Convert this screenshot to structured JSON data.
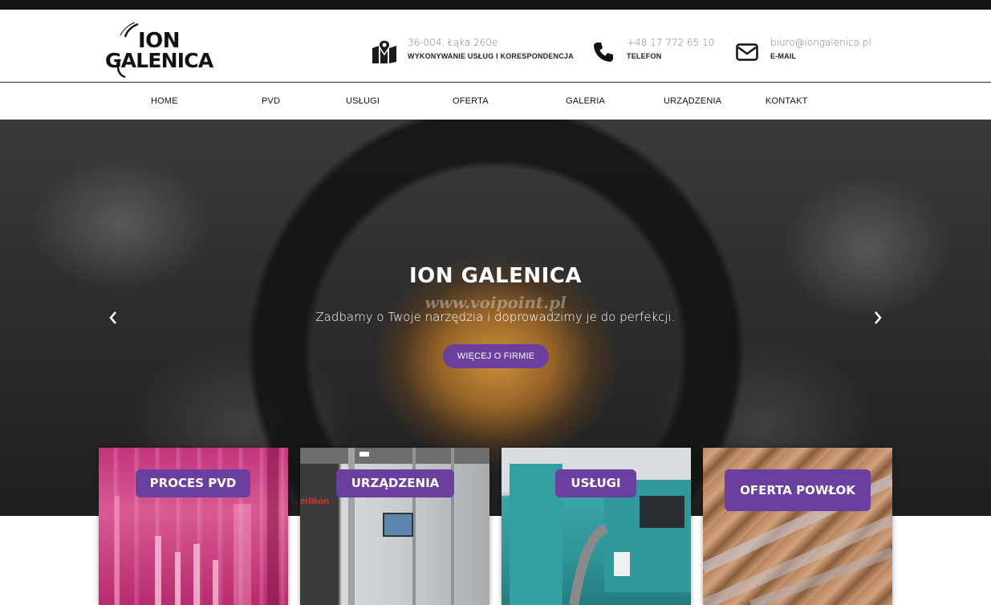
{
  "header": {
    "logo": {
      "line1": "ION",
      "line2": "GALENICA"
    },
    "address": {
      "main": "36-004, Łąka 260e",
      "sub": "WYKONYWANIE USŁUG I KORESPONDENCJA",
      "icon": "map-icon"
    },
    "phone": {
      "main": "+48 17 772 65 10",
      "sub": "TELEFON",
      "icon": "phone-icon"
    },
    "email": {
      "main": "biuro@iongalenica.pl",
      "sub": "E-MAIL",
      "icon": "envelope-icon"
    }
  },
  "nav": {
    "items": [
      "HOME",
      "PVD",
      "USŁUGI",
      "OFERTA",
      "GALERIA",
      "URZĄDZENIA",
      "KONTAKT"
    ]
  },
  "hero": {
    "title": "ION GALENICA",
    "watermark": "www.voipoint.pl",
    "subtitle": "Zadbamy o Twoje narzędzia i doprowadzimy je do perfekcji.",
    "button": "WIĘCEJ O FIRMIE"
  },
  "cards": [
    {
      "label": "PROCES PVD"
    },
    {
      "label": "URZĄDZENIA"
    },
    {
      "label": "USŁUGI"
    },
    {
      "label": "OFERTA POWŁOK"
    }
  ],
  "card_texts": {
    "brand_partial": "erlikon"
  },
  "colors": {
    "accent": "#6a3fa0",
    "topbar": "#141414"
  }
}
